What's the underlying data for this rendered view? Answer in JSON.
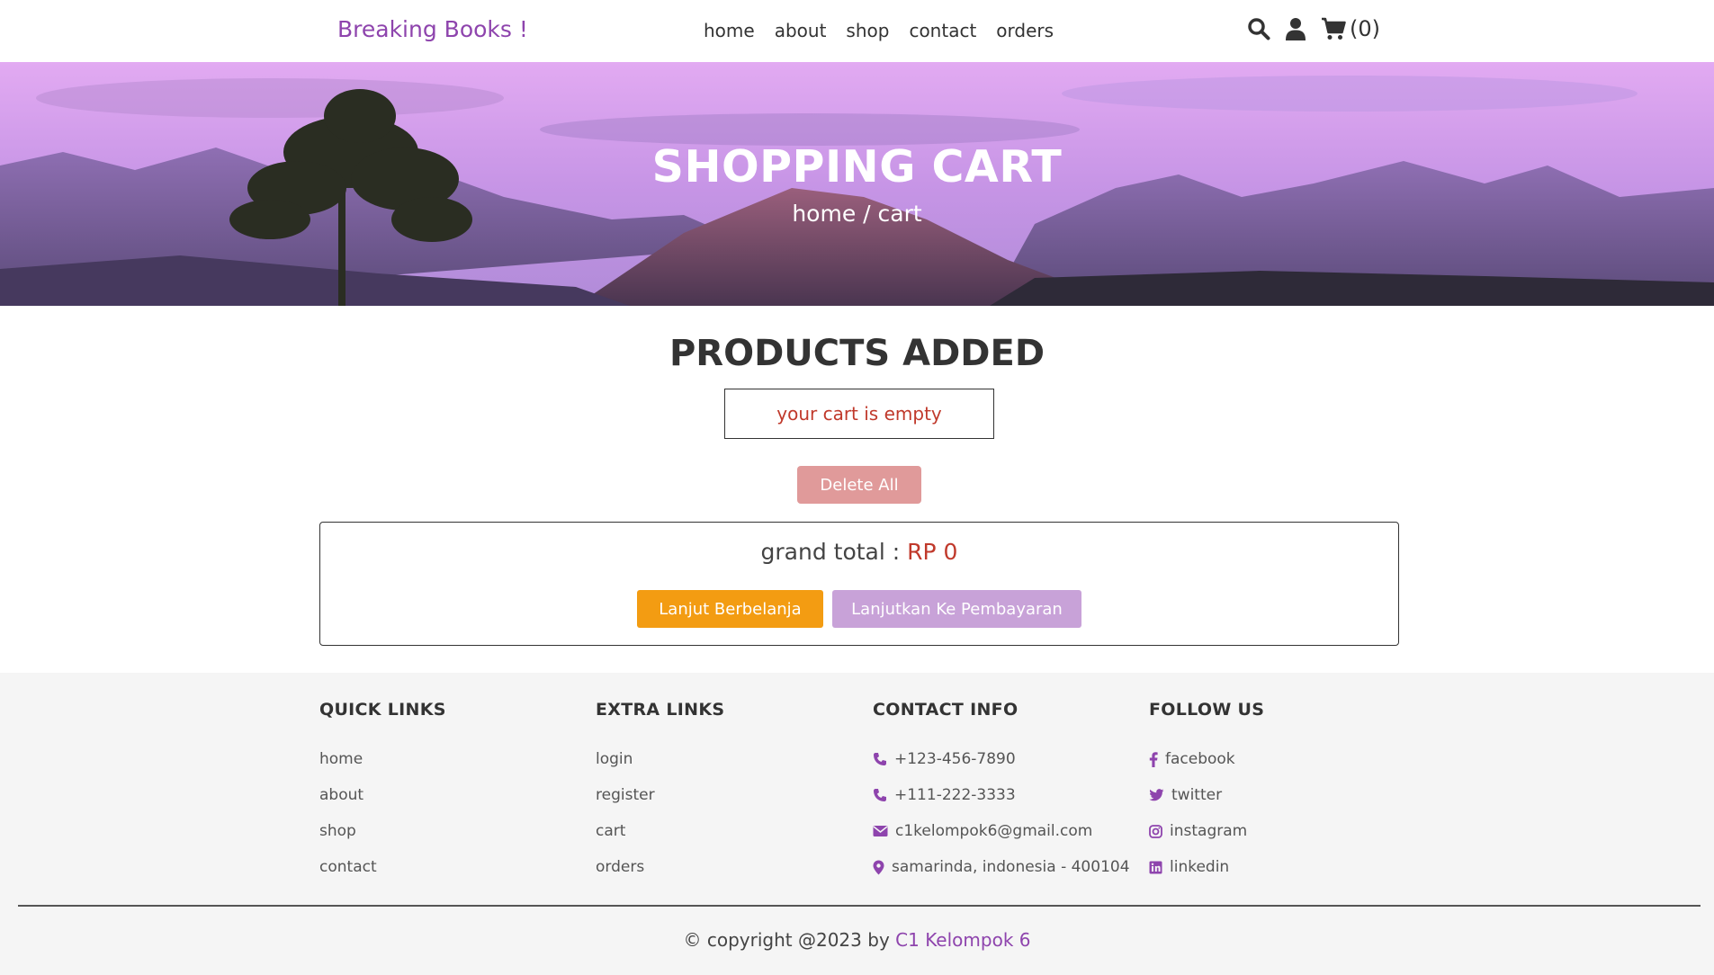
{
  "header": {
    "logo": "Breaking Books !",
    "nav": [
      "home",
      "about",
      "shop",
      "contact",
      "orders"
    ],
    "cart_count": "(0)"
  },
  "hero": {
    "title": "SHOPPING CART",
    "breadcrumb": "home / cart"
  },
  "main": {
    "section_title": "PRODUCTS ADDED",
    "empty_message": "your cart is empty",
    "delete_all_label": "Delete All",
    "grand_total_label": "grand total : ",
    "grand_total_value": "RP 0",
    "continue_label": "Lanjut Berbelanja",
    "checkout_label": "Lanjutkan Ke Pembayaran"
  },
  "footer": {
    "quick_links": {
      "title": "QUICK LINKS",
      "items": [
        "home",
        "about",
        "shop",
        "contact"
      ]
    },
    "extra_links": {
      "title": "EXTRA LINKS",
      "items": [
        "login",
        "register",
        "cart",
        "orders"
      ]
    },
    "contact_info": {
      "title": "CONTACT INFO",
      "items": [
        {
          "icon": "phone-icon",
          "text": "+123-456-7890"
        },
        {
          "icon": "phone-icon",
          "text": "+111-222-3333"
        },
        {
          "icon": "envelope-icon",
          "text": "c1kelompok6@gmail.com"
        },
        {
          "icon": "map-marker-icon",
          "text": "samarinda, indonesia - 400104"
        }
      ]
    },
    "follow_us": {
      "title": "FOLLOW US",
      "items": [
        {
          "icon": "facebook-icon",
          "text": "facebook"
        },
        {
          "icon": "twitter-icon",
          "text": "twitter"
        },
        {
          "icon": "instagram-icon",
          "text": "instagram"
        },
        {
          "icon": "linkedin-icon",
          "text": "linkedin"
        }
      ]
    },
    "copyright_prefix": "© copyright @2023 by ",
    "copyright_brand": "C1 Kelompok 6"
  },
  "colors": {
    "brand": "#8e44ad",
    "danger": "#c0392b",
    "delete_button": "#e09a9a",
    "continue_button": "#f39c12",
    "checkout_button": "#c8a2d8",
    "footer_bg": "#f5f5f5"
  }
}
